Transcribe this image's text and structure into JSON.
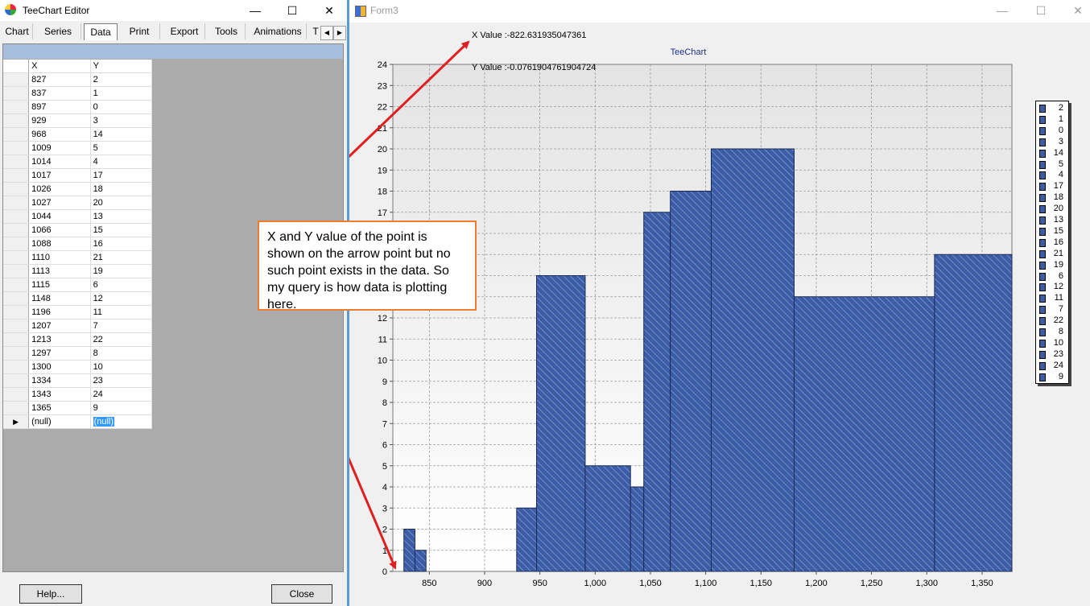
{
  "editor": {
    "title": "TeeChart Editor",
    "tabs": [
      "Chart",
      "Series",
      "Data",
      "Print",
      "Export",
      "Tools",
      "Animations",
      "T"
    ],
    "active_tab": "Data",
    "grid": {
      "headers": [
        "X",
        "Y"
      ],
      "rows": [
        [
          "827",
          "2"
        ],
        [
          "837",
          "1"
        ],
        [
          "897",
          "0"
        ],
        [
          "929",
          "3"
        ],
        [
          "968",
          "14"
        ],
        [
          "1009",
          "5"
        ],
        [
          "1014",
          "4"
        ],
        [
          "1017",
          "17"
        ],
        [
          "1026",
          "18"
        ],
        [
          "1027",
          "20"
        ],
        [
          "1044",
          "13"
        ],
        [
          "1066",
          "15"
        ],
        [
          "1088",
          "16"
        ],
        [
          "1110",
          "21"
        ],
        [
          "1113",
          "19"
        ],
        [
          "1115",
          "6"
        ],
        [
          "1148",
          "12"
        ],
        [
          "1196",
          "11"
        ],
        [
          "1207",
          "7"
        ],
        [
          "1213",
          "22"
        ],
        [
          "1297",
          "8"
        ],
        [
          "1300",
          "10"
        ],
        [
          "1334",
          "23"
        ],
        [
          "1343",
          "24"
        ],
        [
          "1365",
          "9"
        ]
      ],
      "new_row": [
        "(null)",
        "(null)"
      ]
    },
    "help_button": "Help...",
    "close_button": "Close"
  },
  "form": {
    "title": "Form3",
    "x_readout": "X Value :-822.631935047361",
    "y_readout": "Y Value :-0.0761904761904724",
    "callout": "X and Y value of the point is shown on the arrow point but no such point exists in the data. So my query is how data is plotting here."
  },
  "colors": {
    "bar_fill": "#3b5ca6",
    "arrow": "#e02020",
    "callout_border": "#ed7d31",
    "title": "#1f2d8a"
  },
  "chart_data": {
    "type": "bar",
    "title": "TeeChart",
    "xlim": [
      817,
      1377
    ],
    "ylim": [
      0,
      24
    ],
    "x_ticks": [
      850,
      900,
      950,
      1000,
      1050,
      1100,
      1150,
      1200,
      1250,
      1300,
      1350
    ],
    "x_tick_labels": [
      "850",
      "900",
      "950",
      "1,000",
      "1,050",
      "1,100",
      "1,150",
      "1,200",
      "1,250",
      "1,300",
      "1,350"
    ],
    "y_ticks": [
      0,
      1,
      2,
      3,
      4,
      5,
      6,
      7,
      8,
      9,
      10,
      11,
      12,
      13,
      14,
      15,
      16,
      17,
      18,
      19,
      20,
      21,
      22,
      23,
      24
    ],
    "grid": true,
    "legend_position": "right",
    "bars": [
      {
        "x0": 827,
        "x1": 837,
        "y": 2
      },
      {
        "x0": 837,
        "x1": 847,
        "y": 1
      },
      {
        "x0": 929,
        "x1": 947,
        "y": 3
      },
      {
        "x0": 947,
        "x1": 991,
        "y": 14
      },
      {
        "x0": 991,
        "x1": 1032,
        "y": 5
      },
      {
        "x0": 1032,
        "x1": 1044,
        "y": 4
      },
      {
        "x0": 1044,
        "x1": 1068,
        "y": 17
      },
      {
        "x0": 1068,
        "x1": 1105,
        "y": 18
      },
      {
        "x0": 1105,
        "x1": 1180,
        "y": 20
      },
      {
        "x0": 1180,
        "x1": 1307,
        "y": 13
      },
      {
        "x0": 1307,
        "x1": 1377,
        "y": 15
      }
    ],
    "legend": [
      "2",
      "1",
      "0",
      "3",
      "14",
      "5",
      "4",
      "17",
      "18",
      "20",
      "13",
      "15",
      "16",
      "21",
      "19",
      "6",
      "12",
      "11",
      "7",
      "22",
      "8",
      "10",
      "23",
      "24",
      "9"
    ]
  }
}
